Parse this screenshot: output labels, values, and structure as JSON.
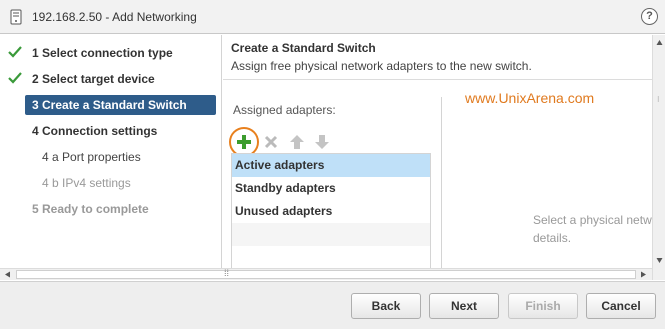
{
  "window": {
    "title": "192.168.2.50 - Add Networking",
    "help_glyph": "?"
  },
  "sidebar": {
    "items": [
      {
        "label": "1  Select connection type",
        "state": "done"
      },
      {
        "label": "2  Select target device",
        "state": "done"
      },
      {
        "label": "3  Create a Standard Switch",
        "state": "active"
      },
      {
        "label": "4  Connection settings",
        "state": "normal"
      },
      {
        "label": "4 a  Port properties",
        "state": "sub"
      },
      {
        "label": "4 b  IPv4 settings",
        "state": "disabled-sub"
      },
      {
        "label": "5  Ready to complete",
        "state": "disabled"
      }
    ]
  },
  "content": {
    "title": "Create a Standard Switch",
    "subtitle": "Assign free physical network adapters to the new switch.",
    "assigned_label": "Assigned adapters:",
    "watermark": "www.UnixArena.com",
    "adapters": [
      "Active adapters",
      "Standby adapters",
      "Unused adapters"
    ],
    "detail_line1": "Select a physical netw",
    "detail_line2": "details."
  },
  "toolbar": {
    "icons": [
      "add-icon",
      "remove-icon",
      "move-up-icon",
      "move-down-icon"
    ]
  },
  "footer": {
    "back_label": "Back",
    "next_label": "Next",
    "finish_label": "Finish",
    "cancel_label": "Cancel"
  },
  "colors": {
    "active_nav": "#2e5c8a",
    "selected_row": "#bfe0f8",
    "check_green": "#3a9a3a",
    "watermark": "#e07a1f"
  }
}
